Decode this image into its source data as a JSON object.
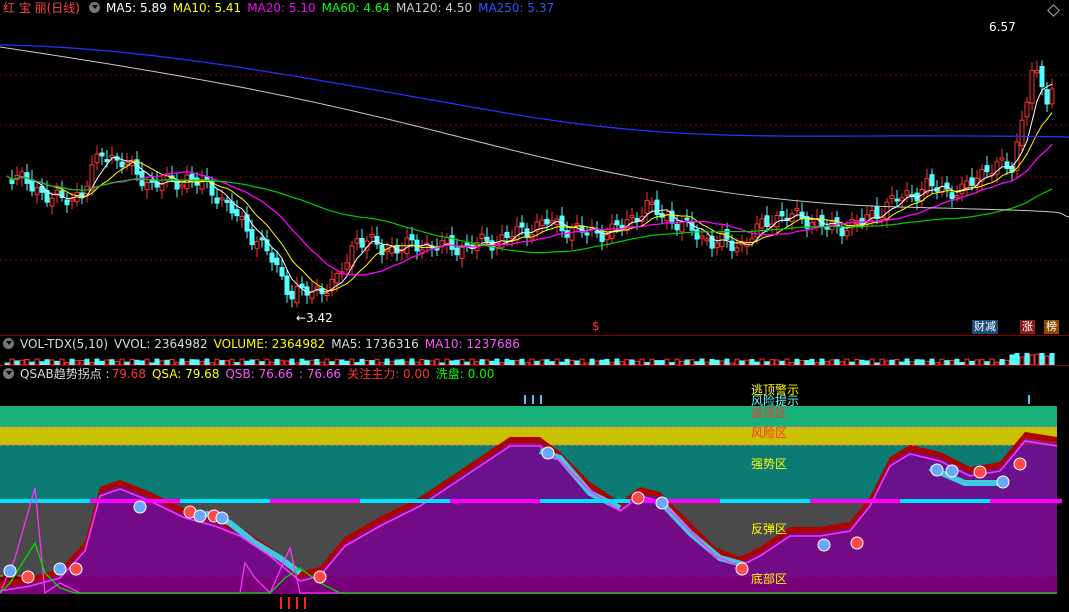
{
  "price_panel": {
    "title": "红 宝 丽(日线)",
    "indicators": [
      {
        "label": "MA5: 5.89",
        "color": "#ffffff"
      },
      {
        "label": "MA10: 5.41",
        "color": "#ffff00"
      },
      {
        "label": "MA20: 5.10",
        "color": "#ff00ff"
      },
      {
        "label": "MA60: 4.64",
        "color": "#00ff00"
      },
      {
        "label": "MA120: 4.50",
        "color": "#cccccc"
      },
      {
        "label": "MA250: 5.37",
        "color": "#3355ff"
      }
    ],
    "high_label": "6.57",
    "low_label": "3.42",
    "low_arrow": "←",
    "marker_dollar": "$",
    "tags": [
      {
        "text": "财减",
        "color": "#ffffff",
        "bg": "#1a5a8a"
      },
      {
        "text": "涨",
        "color": "#ffffff",
        "bg": "#8a1a1a"
      },
      {
        "text": "榜",
        "color": "#ffffff",
        "bg": "#8a4a00"
      }
    ]
  },
  "volume_panel": {
    "title": "VOL-TDX(5,10)",
    "indicators": [
      {
        "label": "VVOL: 2364982",
        "color": "#dddddd"
      },
      {
        "label": "VOLUME: 2364982",
        "color": "#ffff00"
      },
      {
        "label": "MA5: 1736316",
        "color": "#dddddd"
      },
      {
        "label": "MA10: 1237686",
        "color": "#ff55ff"
      }
    ]
  },
  "qsab_panel": {
    "title": "QSAB趋势拐点 :",
    "indicators": [
      {
        "label": "79.68",
        "color": "#ff3333"
      },
      {
        "label": "QSA: 79.68",
        "color": "#ffff00"
      },
      {
        "label": "QSB: 76.66",
        "color": "#ff55ff"
      },
      {
        "label": ": 76.66",
        "color": "#ff55ff"
      },
      {
        "label": "关注主力: 0.00",
        "color": "#ff3333"
      },
      {
        "label": "洗盘: 0.00",
        "color": "#00ff00"
      }
    ],
    "zones": {
      "escape_warning": "逃顶警示",
      "risk_tip": "风险提示",
      "escape_zone": "逃顶区",
      "risk_zone": "风险区",
      "strong_zone": "强势区",
      "rebound_zone": "反弹区",
      "bottom_zone": "底部区"
    }
  },
  "colors": {
    "up": "#ff3232",
    "down": "#54ffff",
    "separator": "#8a0000"
  }
}
